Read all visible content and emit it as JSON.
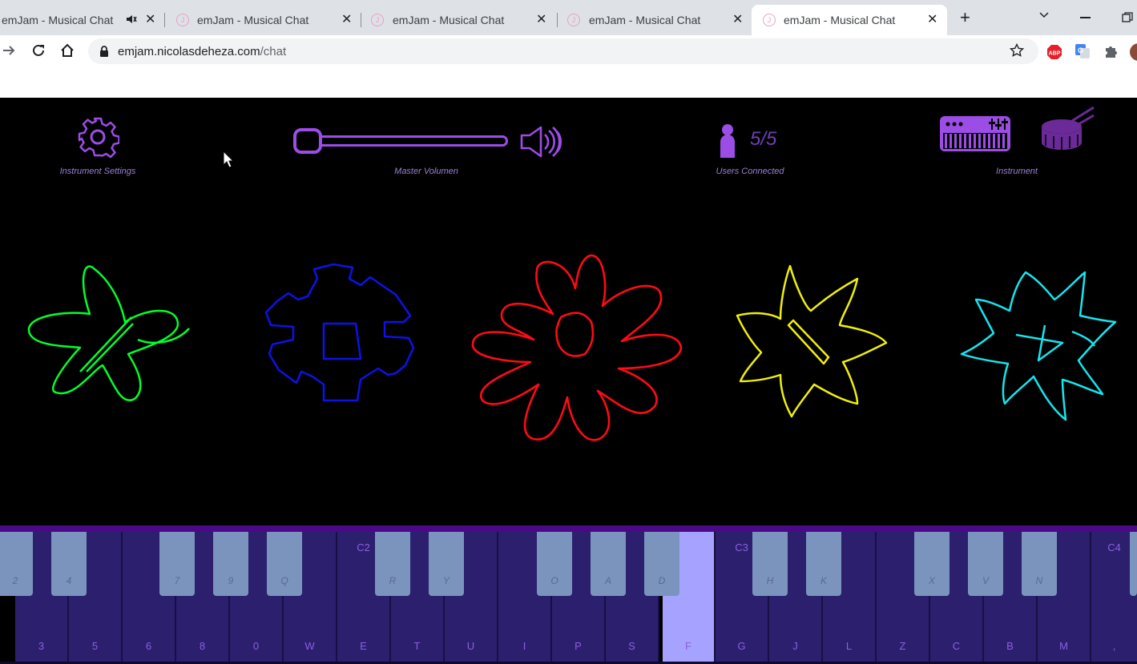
{
  "browser": {
    "tabs": [
      {
        "title": "emJam - Musical Chat",
        "muted": true
      },
      {
        "title": "emJam - Musical Chat"
      },
      {
        "title": "emJam - Musical Chat"
      },
      {
        "title": "emJam - Musical Chat"
      },
      {
        "title": "emJam - Musical Chat",
        "active": true
      }
    ],
    "favicon_letter": "J",
    "url_host": "emjam.nicolasdeheza.com",
    "url_path": "/chat"
  },
  "app": {
    "instrument_settings_label": "Instrument Settings",
    "master_volume_label": "Master Volumen",
    "master_volume_level": 0.0,
    "users_label": "Users Connected",
    "users_count": "5/5",
    "instrument_label": "Instrument",
    "colors": {
      "accent": "#9b4de6",
      "label": "#9d7fd6",
      "users": [
        "#00ff2a",
        "#0d12e8",
        "#ff0a16",
        "#f0f00a",
        "#14e6f0"
      ]
    }
  },
  "keyboard": {
    "white_keys": [
      "3",
      "5",
      "6",
      "8",
      "0",
      "W",
      "E",
      "T",
      "U",
      "I",
      "P",
      "S",
      "F",
      "G",
      "J",
      "L",
      "Z",
      "C",
      "B",
      "M",
      ","
    ],
    "black_keys": [
      "2",
      "4",
      "7",
      "9",
      "Q",
      "R",
      "Y",
      "O",
      "A",
      "D",
      "H",
      "K",
      "X",
      "V",
      "N"
    ],
    "octaves": [
      "C2",
      "C3",
      "C4"
    ],
    "active_key": "F"
  }
}
